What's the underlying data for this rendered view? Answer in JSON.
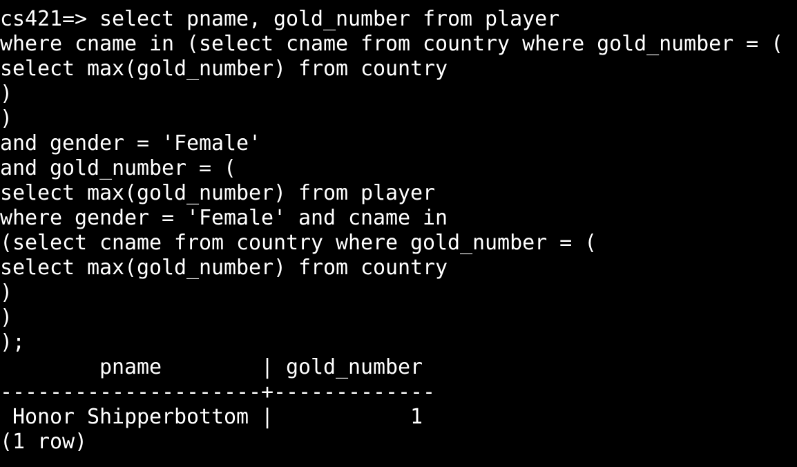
{
  "terminal": {
    "lines": [
      "cs421=> select pname, gold_number from player",
      "where cname in (select cname from country where gold_number = (",
      "select max(gold_number) from country",
      ")",
      ")",
      "and gender = 'Female'",
      "and gold_number = (",
      "select max(gold_number) from player",
      "where gender = 'Female' and cname in",
      "(select cname from country where gold_number = (",
      "select max(gold_number) from country",
      ")",
      ")",
      ");",
      "        pname        | gold_number",
      "---------------------+-------------",
      " Honor Shipperbottom |           1",
      "(1 row)"
    ]
  }
}
